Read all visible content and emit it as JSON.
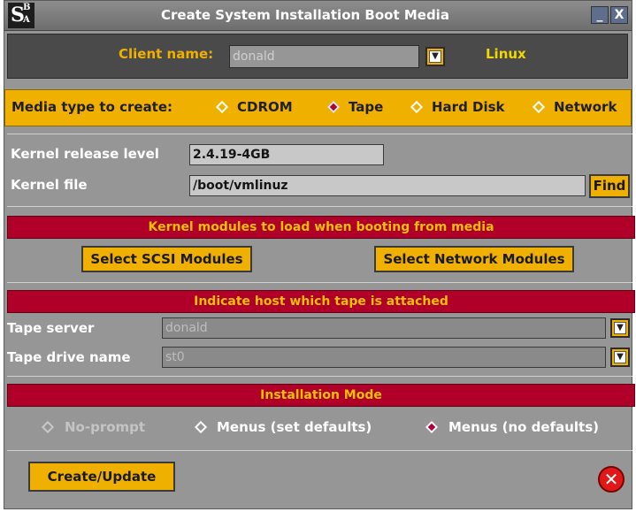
{
  "window": {
    "title": "Create System Installation Boot Media",
    "logo": {
      "big": "S",
      "small_top": "B",
      "small_bottom": "A"
    },
    "minimize_label": "_",
    "close_label": "X"
  },
  "client": {
    "label": "Client name:",
    "value": "donald",
    "dropdown_arrow": "▼",
    "os": "Linux"
  },
  "media": {
    "label": "Media type to create:",
    "options": [
      {
        "label": "CDROM",
        "selected": false
      },
      {
        "label": "Tape",
        "selected": true
      },
      {
        "label": "Hard Disk",
        "selected": false
      },
      {
        "label": "Network",
        "selected": false
      }
    ]
  },
  "kernel": {
    "release_label": "Kernel release level",
    "release_value": "2.4.19-4GB",
    "file_label": "Kernel file",
    "file_value": "/boot/vmlinuz",
    "find_button": "Find"
  },
  "modules": {
    "header": "Kernel modules to load when booting from media",
    "scsi_button": "Select SCSI Modules",
    "network_button": "Select Network Modules"
  },
  "tape": {
    "header": "Indicate host which tape is attached",
    "server_label": "Tape server",
    "server_value": "donald",
    "drive_label": "Tape drive name",
    "drive_value": "st0"
  },
  "install_mode": {
    "header": "Installation Mode",
    "options": [
      {
        "label": "No-prompt",
        "selected": false,
        "disabled": true
      },
      {
        "label": "Menus (set defaults)",
        "selected": false,
        "disabled": false
      },
      {
        "label": "Menus (no defaults)",
        "selected": true,
        "disabled": false
      }
    ]
  },
  "footer": {
    "create_button": "Create/Update",
    "cancel_icon": "✕"
  },
  "colors": {
    "accent": "#f0b000",
    "section_header": "#b0002a",
    "window_bg": "#969696"
  }
}
